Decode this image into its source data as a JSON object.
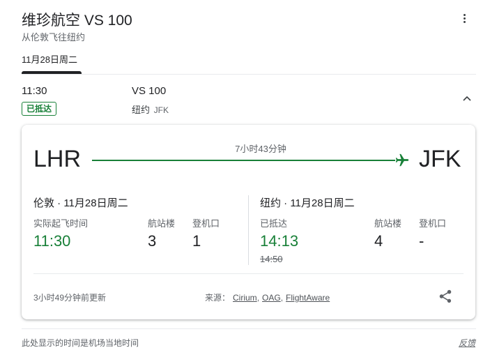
{
  "header": {
    "title": "维珍航空 VS 100",
    "subtitle": "从伦敦飞往纽约",
    "date_tab": "11月28日周二"
  },
  "summary": {
    "departure_time": "11:30",
    "status": "已抵达",
    "flight_number": "VS 100",
    "destination_city": "纽约",
    "destination_code": "JFK"
  },
  "card": {
    "origin_code": "LHR",
    "destination_code": "JFK",
    "duration": "7小时43分钟",
    "departure": {
      "city_date": "伦敦 · 11月28日周二",
      "time_label": "实际起飞时间",
      "time": "11:30",
      "terminal_label": "航站楼",
      "terminal": "3",
      "gate_label": "登机口",
      "gate": "1"
    },
    "arrival": {
      "city_date": "纽约 · 11月28日周二",
      "time_label": "已抵达",
      "time": "14:13",
      "scheduled_time": "14:50",
      "terminal_label": "航站楼",
      "terminal": "4",
      "gate_label": "登机口",
      "gate": "-"
    },
    "updated": "3小时49分钟前更新",
    "source_label": "来源：",
    "sources": [
      "Cirium",
      "OAG",
      "FlightAware"
    ],
    "source_separator": ","
  },
  "footer": {
    "note": "此处显示的时间是机场当地时间",
    "feedback": "反馈"
  },
  "colors": {
    "accent_green": "#188038",
    "text": "#202124",
    "muted": "#5f6368"
  }
}
